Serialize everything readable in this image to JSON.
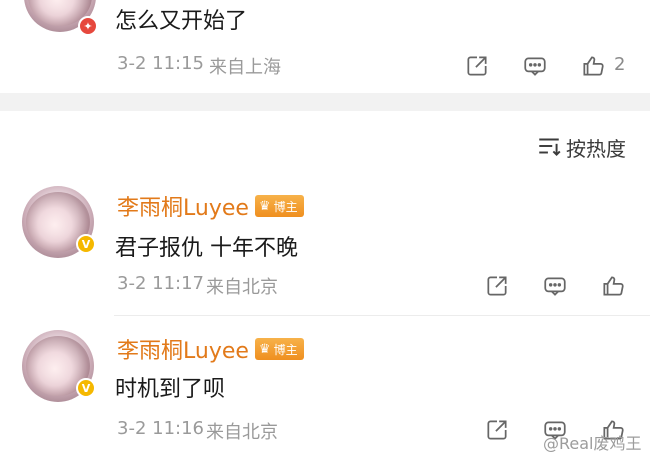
{
  "top_comment": {
    "content": "怎么又开始了",
    "time": "3-2 11:15",
    "location": "来自上海",
    "like_count": "2",
    "badge_color": "#e6483d"
  },
  "sort": {
    "label": "按热度",
    "icon": "sort-lines-icon"
  },
  "comments": [
    {
      "name": "李雨桐Luyee",
      "badge": "博主",
      "content": "君子报仇 十年不晚",
      "time": "3-2 11:17",
      "location": "来自北京"
    },
    {
      "name": "李雨桐Luyee",
      "badge": "博主",
      "content": "时机到了呗",
      "time": "3-2 11:16",
      "location": "来自北京"
    }
  ],
  "watermark": "@Real废鸡王",
  "colors": {
    "name": "#e27a1a",
    "meta": "#9a9a9a",
    "verified": "#f5b800",
    "separator": "#f2f2f2"
  }
}
